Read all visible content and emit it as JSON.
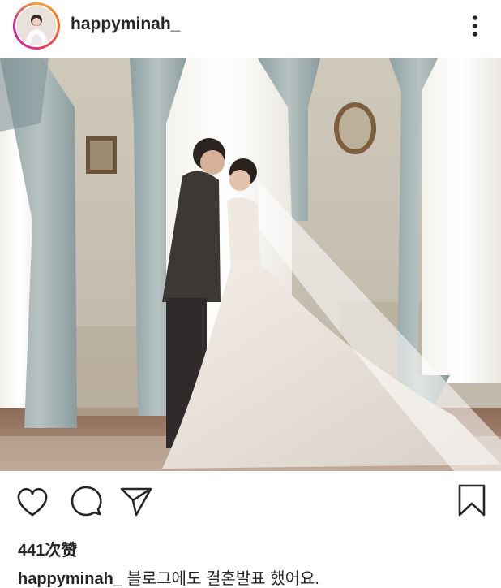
{
  "post": {
    "username": "happyminah_",
    "likes_text": "441次赞",
    "caption_user": "happyminah_",
    "caption_text": " 블로그에도 결혼발표 했어요."
  },
  "icons": {
    "more": "more-vertical-icon",
    "like": "heart-icon",
    "comment": "comment-bubble-icon",
    "share": "paper-plane-icon",
    "save": "bookmark-icon"
  },
  "colors": {
    "text": "#262626",
    "story_ring_start": "#f9a233",
    "story_ring_end": "#b62a8e"
  }
}
